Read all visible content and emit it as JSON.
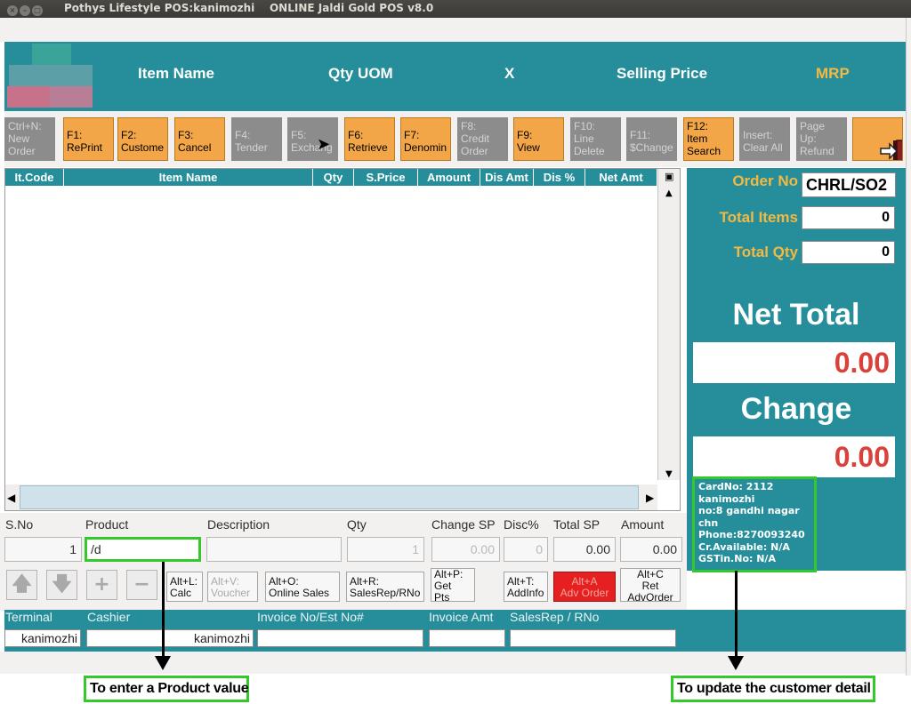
{
  "window": {
    "title": "Pothys Lifestyle POS:kanimozhi    ONLINE Jaldi Gold POS v8.0"
  },
  "header": {
    "columns": [
      "Item Name",
      "Qty UOM",
      "X",
      "Selling Price",
      "MRP"
    ],
    "colors": {
      "bar": "#258e9a",
      "mrp": "#f4b942"
    }
  },
  "toolbar": {
    "buttons": [
      {
        "label": "Ctrl+N:\nNew\nOrder",
        "enabled": false
      },
      {
        "label": "F1:\nRePrint",
        "enabled": true
      },
      {
        "label": "F2:\nCustome",
        "enabled": true
      },
      {
        "label": "F3:\nCancel",
        "enabled": true
      },
      {
        "label": "F4:\nTender",
        "enabled": false
      },
      {
        "label": "F5:\nExchang",
        "enabled": false
      },
      {
        "label": "F6:\nRetrieve",
        "enabled": true
      },
      {
        "label": "F7:\nDenomin",
        "enabled": true
      },
      {
        "label": "F8:\nCredit\nOrder",
        "enabled": false
      },
      {
        "label": "F9:\nView",
        "enabled": true
      },
      {
        "label": "F10:\nLine\nDelete",
        "enabled": false
      },
      {
        "label": "F11:\n$Change",
        "enabled": false
      },
      {
        "label": "F12:\nItem\nSearch",
        "enabled": true
      },
      {
        "label": "Insert:\nClear All",
        "enabled": false
      },
      {
        "label": "Page\nUp:\nRefund",
        "enabled": false
      }
    ],
    "exit_icon": "exit-door-icon"
  },
  "grid": {
    "columns": [
      "It.Code",
      "Item Name",
      "Qty",
      "S.Price",
      "Amount",
      "Dis Amt",
      "Dis %",
      "Net Amt"
    ]
  },
  "summary": {
    "order_no_label": "Order No",
    "order_no": "CHRL/SO2",
    "total_items_label": "Total Items",
    "total_items": "0",
    "total_qty_label": "Total Qty",
    "total_qty": "0",
    "net_total_label": "Net Total",
    "net_total": "0.00",
    "change_label": "Change",
    "change": "0.00"
  },
  "customer": {
    "lines": [
      "CardNo: 2112",
      "kanimozhi",
      "no:8 gandhi nagar",
      "chn",
      "Phone:8270093240",
      "Cr.Available: N/A",
      "GSTin.No: N/A"
    ]
  },
  "entry": {
    "labels": [
      "S.No",
      "Product",
      "Description",
      "Qty",
      "Change SP",
      "Disc%",
      "Total SP",
      "Amount"
    ],
    "sno": "1",
    "product": "/d",
    "description": "",
    "qty": "1",
    "change_sp": "0.00",
    "disc": "0",
    "total_sp": "0.00",
    "amount": "0.00"
  },
  "actions": {
    "calc": "Alt+L:\nCalc",
    "voucher": "Alt+V:\nVoucher",
    "online_sales": "Alt+O:\nOnline Sales",
    "salesrep": "Alt+R:\nSalesRep/RNo",
    "get_pts": "Alt+P:\nGet\nPts",
    "addinfo": "Alt+T:\nAddInfo",
    "adv_order": "Alt+A\nAdv Order",
    "ret_adv_order": "Alt+C\nRet\nAdvOrder"
  },
  "footer": {
    "labels": [
      "Terminal",
      "Cashier",
      "Invoice No/Est No#",
      "Invoice Amt",
      "SalesRep / RNo"
    ],
    "terminal": "kanimozhi",
    "cashier": "kanimozhi"
  },
  "annotations": {
    "product": "To enter a Product value",
    "customer": "To update the customer detail"
  }
}
